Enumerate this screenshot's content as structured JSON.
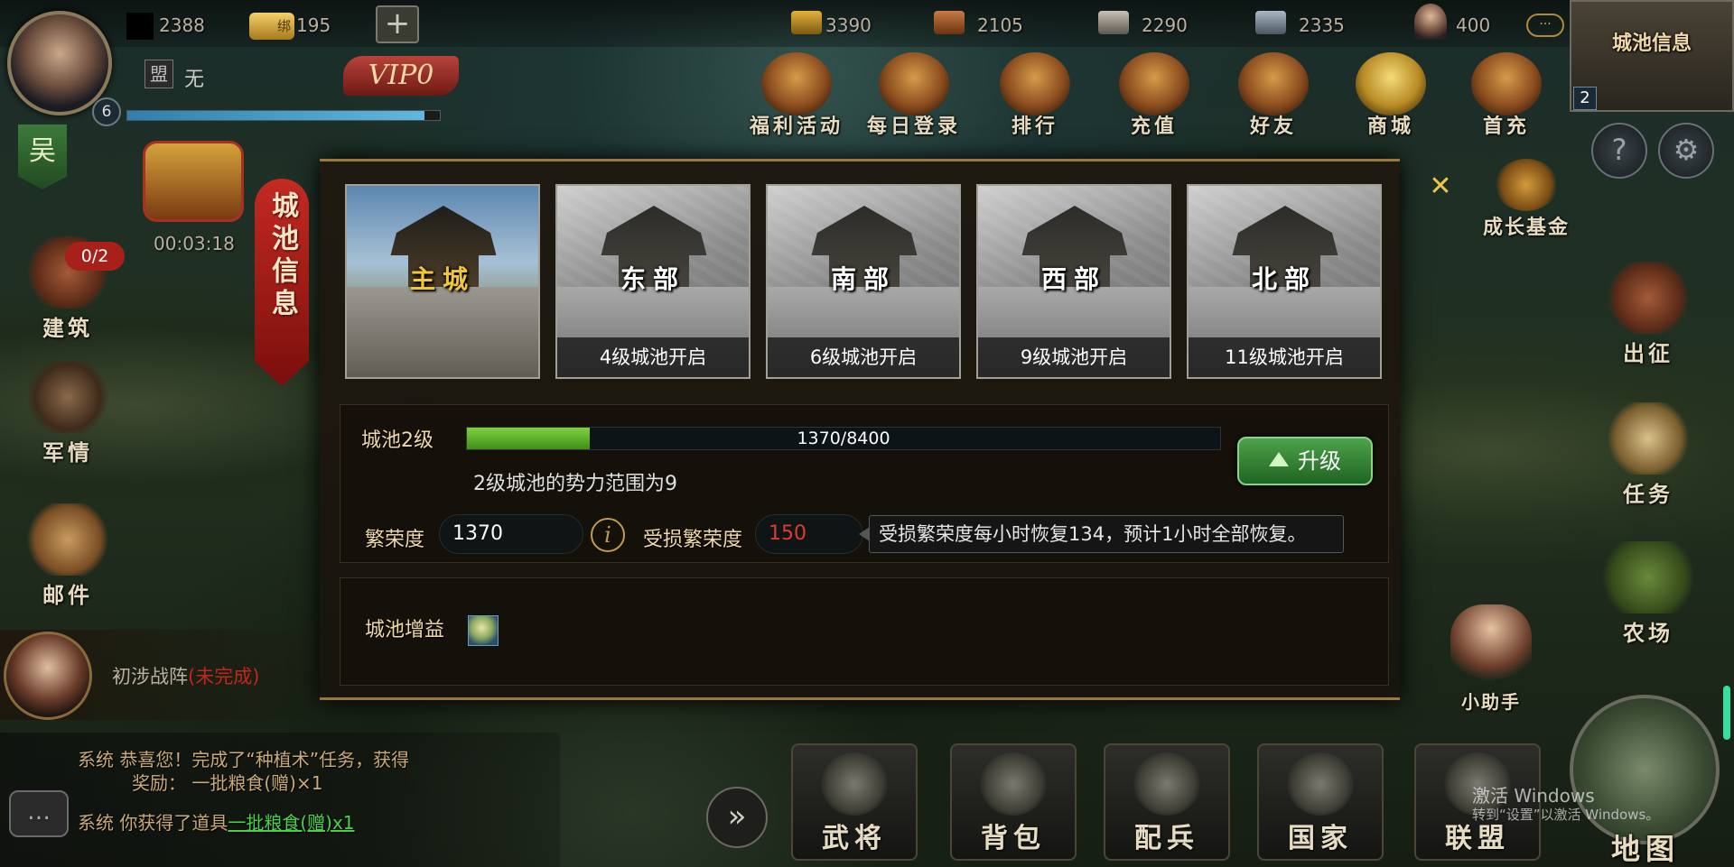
{
  "player": {
    "level": "6",
    "alliance_label": "盟",
    "alliance_name": "无",
    "vip": "VIP0",
    "exp_fraction": 0.95
  },
  "currency": {
    "gold": "2388",
    "bound_gold": "195",
    "bound_tag": "绑"
  },
  "resources": [
    {
      "icon": "grain-icon",
      "value": "3390"
    },
    {
      "icon": "wood-icon",
      "value": "2105"
    },
    {
      "icon": "stone-icon",
      "value": "2290"
    },
    {
      "icon": "iron-icon",
      "value": "2335"
    },
    {
      "icon": "population-icon",
      "value": "400"
    }
  ],
  "more_label": "···",
  "top_right": {
    "title": "城池信息",
    "badge": "2"
  },
  "activities": [
    "福利活动",
    "每日登录",
    "排行",
    "充值",
    "好友",
    "商城",
    "首充"
  ],
  "growth_fund": "成长基金",
  "left_menu": {
    "flag": "吴",
    "chest_timer": "00:03:18",
    "build_badge": "0/2",
    "build": "建筑",
    "military": "军情",
    "mail": "邮件"
  },
  "right_menu": {
    "expedition": "出征",
    "task": "任务",
    "farm": "农场",
    "assistant": "小助手"
  },
  "panel": {
    "title": "城池信息",
    "cities": [
      {
        "name": "主城",
        "caption": ""
      },
      {
        "name": "东部",
        "caption": "4级城池开启"
      },
      {
        "name": "南部",
        "caption": "6级城池开启"
      },
      {
        "name": "西部",
        "caption": "9级城池开启"
      },
      {
        "name": "北部",
        "caption": "11级城池开启"
      }
    ],
    "level_label": "城池2级",
    "progress": {
      "current": 1370,
      "max": 8400,
      "text": "1370/8400"
    },
    "range_text": "2级城池的势力范围为9",
    "upgrade_label": "升级",
    "prosperity_label": "繁荣度",
    "prosperity_value": "1370",
    "damaged_label": "受损繁荣度",
    "damaged_value": "150",
    "tooltip": "受损繁荣度每小时恢复134，预计1小时全部恢复。",
    "bonus_label": "城池增益"
  },
  "quest": {
    "name": "初涉战阵",
    "status": "(未完成)"
  },
  "chat": [
    {
      "channel": "系统",
      "text": "恭喜您！完成了“种植术”任务，获得",
      "text2": "奖励：  一批粮食(赠)×1"
    },
    {
      "channel": "系统",
      "text": "你获得了道具",
      "link": "一批粮食(赠)x1"
    }
  ],
  "bottom_menu": [
    "武将",
    "背包",
    "配兵",
    "国家",
    "联盟"
  ],
  "map_label": "地图",
  "watermark": {
    "line1": "激活 Windows",
    "line2": "转到“设置”以激活 Windows。"
  },
  "colors": {
    "accent_gold": "#f0d9a6",
    "progress_green": "#7fd13e",
    "damage_red": "#e03a2e",
    "banner_red": "#c32a22",
    "link_green": "#4cd04c"
  }
}
